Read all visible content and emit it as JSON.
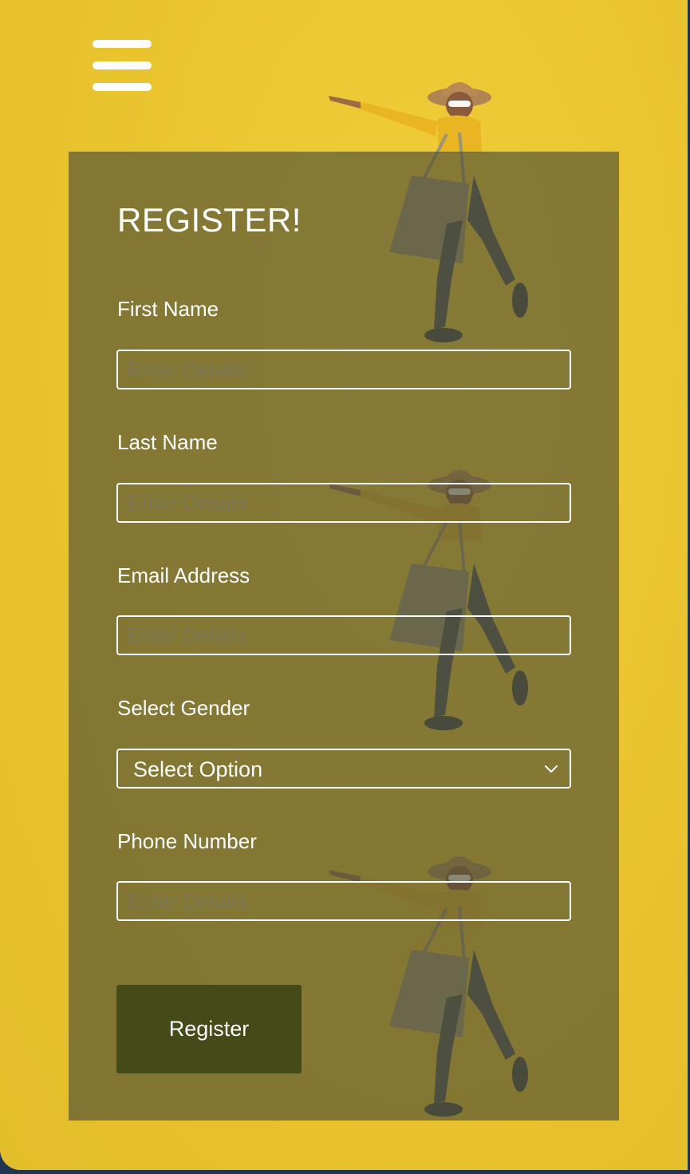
{
  "form": {
    "title": "REGISTER!",
    "fields": [
      {
        "label": "First Name",
        "placeholder": "Enter Details",
        "value": ""
      },
      {
        "label": "Last Name",
        "placeholder": "Enter Details",
        "value": ""
      },
      {
        "label": "Email Address",
        "placeholder": "Enter Details",
        "value": ""
      },
      {
        "label": "Phone Number",
        "placeholder": "Enter Details",
        "value": ""
      }
    ],
    "gender": {
      "label": "Select Gender",
      "selected": "Select Option"
    },
    "submit_label": "Register"
  },
  "icons": {
    "menu": "hamburger-menu-icon",
    "dropdown": "chevron-down-icon"
  },
  "colors": {
    "background": "#ebc633",
    "panel": "#545236",
    "button": "#454a19",
    "text": "#ffffff"
  }
}
